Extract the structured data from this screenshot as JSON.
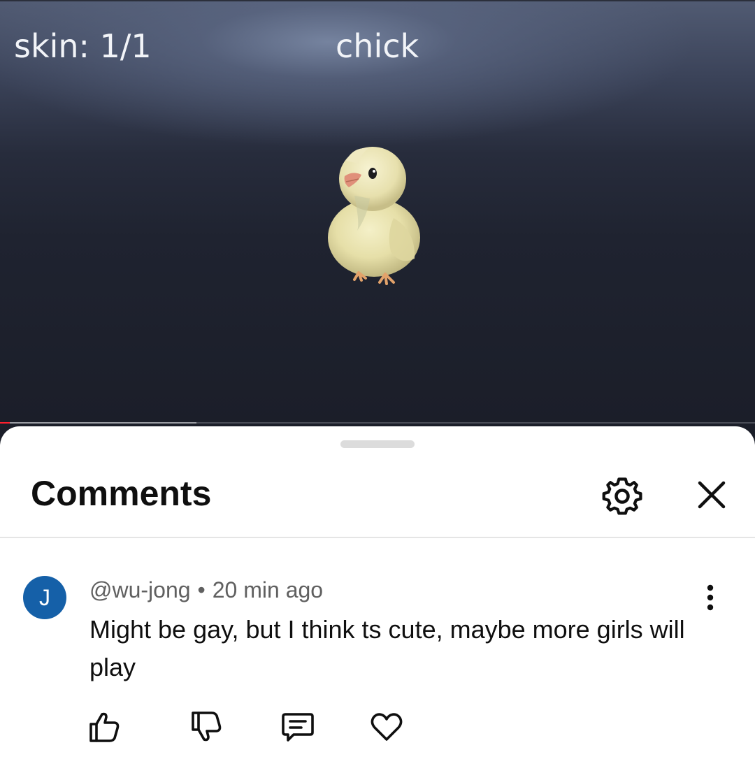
{
  "video": {
    "skin_label": "skin: 1/1",
    "character_name": "chick",
    "progress_fraction": 0.013,
    "buffered_fraction": 0.26,
    "accent_color": "#ff1f2d"
  },
  "comments_panel": {
    "title": "Comments",
    "settings_icon": "gear-icon",
    "close_icon": "close-icon"
  },
  "comment": {
    "avatar_initial": "J",
    "avatar_color": "#1560a8",
    "author": "@wu-jong",
    "separator": "•",
    "time": "20 min ago",
    "text": "Might be gay, but I think ts cute, maybe more girls will play",
    "more_icon": "more-vertical-icon",
    "actions": {
      "like_icon": "thumbs-up-icon",
      "dislike_icon": "thumbs-down-icon",
      "reply_icon": "reply-comment-icon",
      "heart_icon": "heart-icon"
    }
  }
}
